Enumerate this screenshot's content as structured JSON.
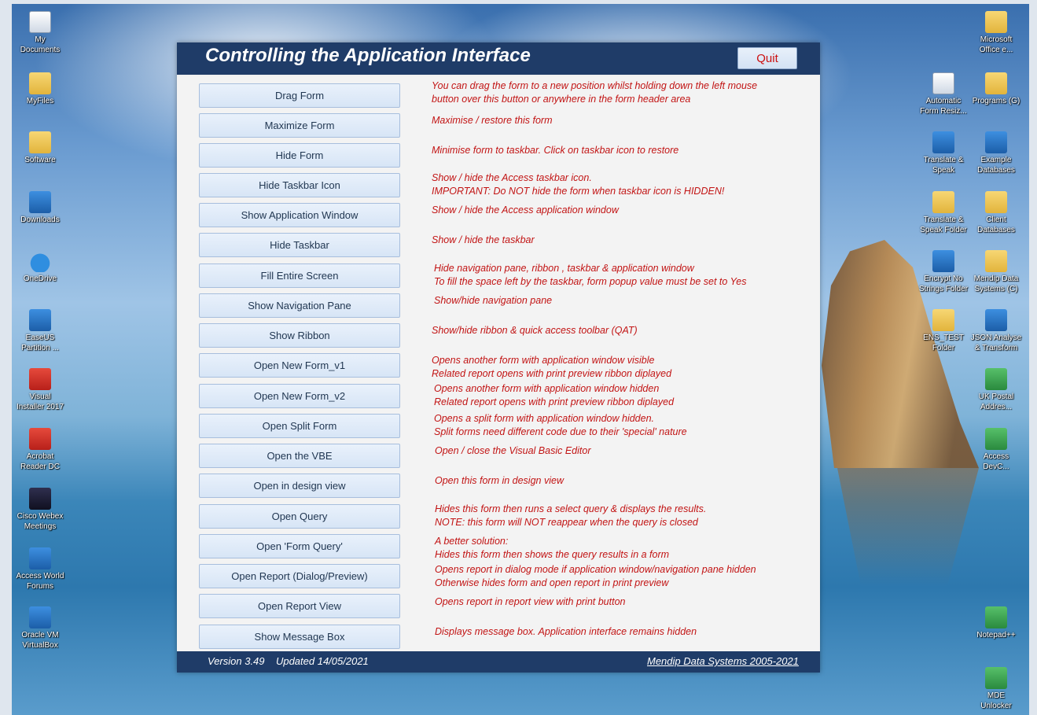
{
  "form": {
    "title": "Controlling the Application Interface",
    "quit_label": "Quit",
    "footer_version": "Version 3.49    Updated 14/05/2021",
    "footer_link": "Mendip Data Systems 2005-2021",
    "buttons": [
      {
        "label": "Drag Form"
      },
      {
        "label": "Maximize Form"
      },
      {
        "label": "Hide Form"
      },
      {
        "label": "Hide Taskbar Icon"
      },
      {
        "label": "Show Application Window"
      },
      {
        "label": "Hide Taskbar"
      },
      {
        "label": "Fill Entire Screen"
      },
      {
        "label": "Show Navigation Pane"
      },
      {
        "label": "Show Ribbon"
      },
      {
        "label": "Open New Form_v1"
      },
      {
        "label": "Open New Form_v2"
      },
      {
        "label": "Open Split Form"
      },
      {
        "label": "Open the VBE"
      },
      {
        "label": "Open in design view"
      },
      {
        "label": "Open Query"
      },
      {
        "label": "Open 'Form Query'"
      },
      {
        "label": "Open Report (Dialog/Preview)"
      },
      {
        "label": "Open Report View"
      },
      {
        "label": "Show Message Box"
      }
    ],
    "descriptions": [
      {
        "l1": "You can drag the form to a new position whilst holding down the left mouse",
        "l2": "button over this button or anywhere in the form header area"
      },
      {
        "l1": "Maximise / restore this form"
      },
      {
        "l1": "Minimise form to taskbar. Click on taskbar icon to restore"
      },
      {
        "l1": "Show / hide the Access taskbar icon.",
        "l2": "IMPORTANT: Do NOT hide the form when taskbar icon is HIDDEN!"
      },
      {
        "l1": "Show / hide the Access application window"
      },
      {
        "l1": "Show / hide the taskbar"
      },
      {
        "l1": "Hide navigation pane, ribbon , taskbar & application window",
        "l2": "To fill the space left by the taskbar, form popup value must be set to Yes"
      },
      {
        "l1": "Show/hide navigation pane"
      },
      {
        "l1": "Show/hide ribbon & quick access toolbar (QAT)"
      },
      {
        "l1": "Opens another form with application window visible",
        "l2": "Related report opens with print preview ribbon diplayed"
      },
      {
        "l1": "Opens another form with application window hidden",
        "l2": "Related report opens with print preview ribbon diplayed"
      },
      {
        "l1": "Opens a split form with application window hidden.",
        "l2": "Split forms need different code due to their 'special' nature"
      },
      {
        "l1": "Open / close the Visual Basic Editor"
      },
      {
        "l1": "Open this form in design view"
      },
      {
        "l1": "Hides this form then runs a select query & displays the results.",
        "l2": "NOTE: this form will NOT reappear when the query is closed"
      },
      {
        "l1": "A better solution:",
        "l2": "Hides this form then shows the query results in a form"
      },
      {
        "l1": "Opens report in dialog mode if application window/navigation pane hidden",
        "l2": "Otherwise hides form and open report  in print preview"
      },
      {
        "l1": "Opens report in report view with print button"
      },
      {
        "l1": "Displays message box. Application interface remains hidden"
      }
    ]
  },
  "desktop": {
    "left_icons": [
      {
        "label1": "My",
        "label2": "Documents",
        "icon": "documents-icon"
      },
      {
        "label1": "MyFiles",
        "icon": "folder-icon"
      },
      {
        "label1": "Software",
        "icon": "folder-icon"
      },
      {
        "label1": "Downloads",
        "icon": "download-icon"
      },
      {
        "label1": "OneDrive",
        "icon": "cloud-icon"
      },
      {
        "label1": "EaseUS",
        "label2": "Partition ...",
        "icon": "partition-icon"
      },
      {
        "label1": "Visual",
        "label2": "Installer 2017",
        "icon": "installer-icon"
      },
      {
        "label1": "Acrobat",
        "label2": "Reader DC",
        "icon": "pdf-icon"
      },
      {
        "label1": "Cisco Webex",
        "label2": "Meetings",
        "icon": "webex-icon"
      },
      {
        "label1": "Access World",
        "label2": "Forums",
        "icon": "globe-icon"
      },
      {
        "label1": "Oracle VM",
        "label2": "VirtualBox",
        "icon": "virtualbox-icon"
      }
    ],
    "right_icons": [
      {
        "label1": "Microsoft",
        "label2": "Office e...",
        "icon": "office-icon"
      },
      {
        "label1": "Automatic",
        "label2": "Form Resiz...",
        "icon": "document-icon"
      },
      {
        "label1": "Programs (G)",
        "icon": "folder-icon"
      },
      {
        "label1": "Translate &",
        "label2": "Speak",
        "icon": "globe-icon"
      },
      {
        "label1": "Example",
        "label2": "Databases",
        "icon": "database-icon"
      },
      {
        "label1": "Translate &",
        "label2": "Speak Folder",
        "icon": "folder-icon"
      },
      {
        "label1": "Client",
        "label2": "Databases",
        "icon": "folder-icon"
      },
      {
        "label1": "Encrypt No",
        "label2": "Strings Folder",
        "icon": "shield-icon"
      },
      {
        "label1": "Mendip Data",
        "label2": "Systems (C)",
        "icon": "folder-icon"
      },
      {
        "label1": "ENS_TEST",
        "label2": "Folder",
        "icon": "folder-icon"
      },
      {
        "label1": "JSON Analyse",
        "label2": "& Transform",
        "icon": "globe-icon"
      },
      {
        "label1": "UK Postal",
        "label2": "Addres...",
        "icon": "postal-icon"
      },
      {
        "label1": "Access",
        "label2": "DevC...",
        "icon": "edge-dev-icon"
      },
      {
        "label1": "Notepad++",
        "icon": "notepad-icon"
      },
      {
        "label1": "MDE",
        "label2": "Unlocker",
        "icon": "unlock-icon"
      }
    ]
  }
}
